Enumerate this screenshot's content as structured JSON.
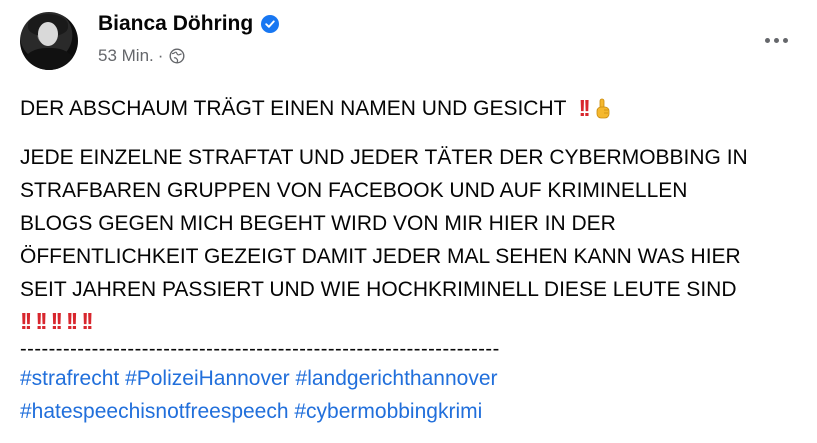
{
  "post": {
    "author": "Bianca Döhring",
    "time": "53 Min.",
    "separator": "·",
    "visibility_icon": "globe-icon",
    "verified_icon": "verified-badge-icon",
    "more_icon": "more-options-icon",
    "line1": "DER ABSCHAUM TRÄGT EINEN NAMEN UND GESICHT",
    "line1_emojis": "‼️☝️",
    "body_lines": [
      "JEDE EINZELNE STRAFTAT UND JEDER TÄTER DER CYBERMOBBING IN",
      "STRAFBAREN GRUPPEN VON FACEBOOK UND AUF KRIMINELLEN",
      "BLOGS GEGEN MICH BEGEHT WIRD VON MIR HIER IN DER",
      "ÖFFENTLICHKEIT GEZEIGT DAMIT JEDER MAL SEHEN KANN WAS HIER",
      "SEIT JAHREN PASSIERT UND WIE HOCHKRIMINELL DIESE LEUTE SIND"
    ],
    "bang": "!!",
    "divider": "-------------------------------------------------------------------",
    "hashtags_line1": [
      "#strafrecht",
      "#PolizeiHannover",
      "#landgerichthannover"
    ],
    "hashtags_line2": [
      "#hatespeechisnotfreespeech",
      "#cybermobbingkrimi"
    ],
    "colors": {
      "link": "#216fdb",
      "verified": "#1877f2",
      "meta": "#65676b",
      "emoji_red": "#d8262d"
    }
  }
}
